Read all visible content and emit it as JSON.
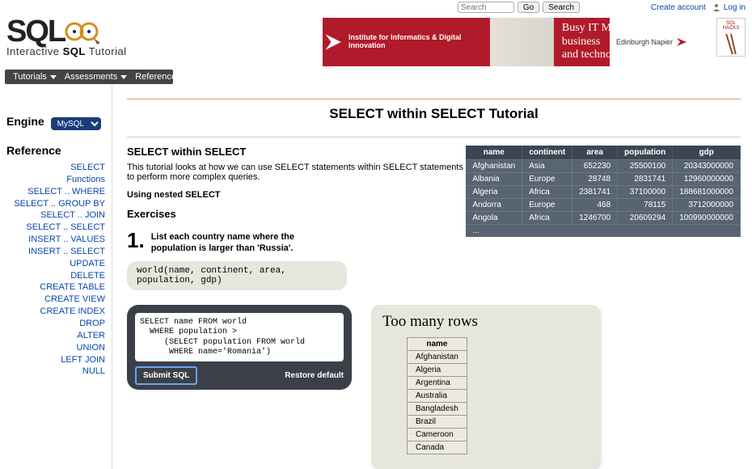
{
  "topbar": {
    "search_placeholder": "Search",
    "go_label": "Go",
    "search_label": "Search",
    "create_account": "Create account",
    "login": "Log in"
  },
  "logo": {
    "line1": "SQL",
    "subtitle_pre": "Interactive ",
    "subtitle_bold": "SQL",
    "subtitle_post": " Tutorial"
  },
  "banner": {
    "inst": "Institute for Informatics & Digital Innovation",
    "msg1": "Busy IT Manager? New business",
    "msg2": "and technology challenges?",
    "uni": "Edinburgh Napier"
  },
  "hacks_label": "SQL HACKS",
  "menubar": [
    {
      "label": "Tutorials"
    },
    {
      "label": "Assessments"
    },
    {
      "label": "Reference"
    }
  ],
  "sidebar": {
    "engine_label": "Engine",
    "engine_value": "MySQL",
    "reference_label": "Reference",
    "items": [
      "SELECT",
      "Functions",
      "SELECT .. WHERE",
      "SELECT .. GROUP BY",
      "SELECT .. JOIN",
      "SELECT .. SELECT",
      "INSERT .. VALUES",
      "INSERT .. SELECT",
      "UPDATE",
      "DELETE",
      "CREATE TABLE",
      "CREATE VIEW",
      "CREATE INDEX",
      "DROP",
      "ALTER",
      "UNION",
      "LEFT JOIN",
      "NULL"
    ]
  },
  "page": {
    "title": "SELECT within SELECT Tutorial",
    "section_heading": "SELECT within SELECT",
    "intro": "This tutorial looks at how we can use SELECT statements within SELECT statements to perform more complex queries.",
    "sub": "Using nested SELECT",
    "exercises_heading": "Exercises",
    "ex_num": "1",
    "ex_text": "List each country name where the population is larger than 'Russia'.",
    "schema": "world(name, continent, area, population, gdp)",
    "editor_sql": "SELECT name FROM world\n  WHERE population >\n     (SELECT population FROM world\n      WHERE name='Romania')",
    "submit_label": "Submit SQL",
    "restore_label": "Restore default"
  },
  "world_table": {
    "headers": [
      "name",
      "continent",
      "area",
      "population",
      "gdp"
    ],
    "rows": [
      [
        "Afghanistan",
        "Asia",
        "652230",
        "25500100",
        "20343000000"
      ],
      [
        "Albania",
        "Europe",
        "28748",
        "2831741",
        "12960000000"
      ],
      [
        "Algeria",
        "Africa",
        "2381741",
        "37100000",
        "188681000000"
      ],
      [
        "Andorra",
        "Europe",
        "468",
        "78115",
        "3712000000"
      ],
      [
        "Angola",
        "Africa",
        "1246700",
        "20609294",
        "100990000000"
      ]
    ],
    "ellipsis": "..."
  },
  "result": {
    "title": "Too many rows",
    "header": "name",
    "rows": [
      "Afghanistan",
      "Algeria",
      "Argentina",
      "Australia",
      "Bangladesh",
      "Brazil",
      "Cameroon",
      "Canada"
    ]
  }
}
